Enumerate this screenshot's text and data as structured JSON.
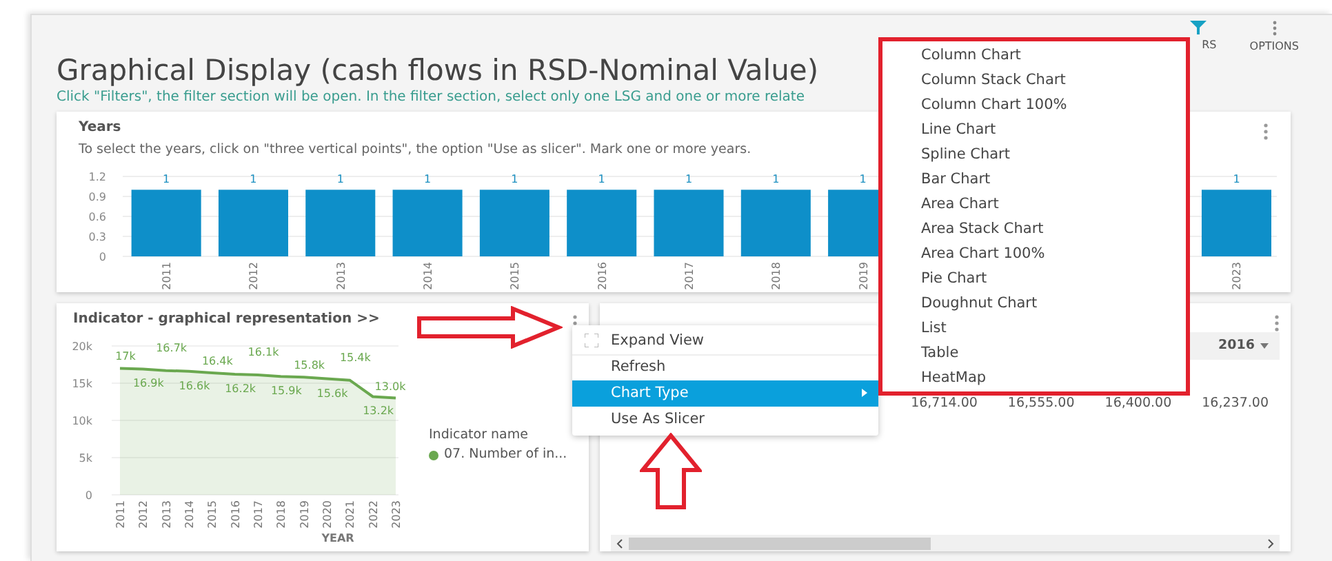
{
  "toolbar": {
    "filters_label": "RS",
    "options_label": "OPTIONS"
  },
  "page": {
    "title": "Graphical Display (cash flows in RSD-Nominal Value)",
    "hint": "Click \"Filters\", the filter section will be open. In the filter section, select only one LSG and one or more relate"
  },
  "years_card": {
    "title": "Years",
    "description": "To select the years, click on \"three vertical points\", the option \"Use as slicer\". Mark one or more years.",
    "chart_data": {
      "type": "bar",
      "categories": [
        "2011",
        "2012",
        "2013",
        "2014",
        "2015",
        "2016",
        "2017",
        "2018",
        "2019",
        null,
        null,
        null,
        "2023"
      ],
      "series": [
        {
          "color": "#0e8fc9",
          "values": [
            1,
            1,
            1,
            1,
            1,
            1,
            1,
            1,
            1,
            null,
            null,
            null,
            1
          ]
        }
      ],
      "ylim": [
        0,
        1.2
      ],
      "yticks": [
        0,
        0.3,
        0.6,
        0.9,
        1.2
      ],
      "grid": true,
      "data_labels": true
    }
  },
  "indicator_card": {
    "title": "Indicator - graphical representation >>",
    "legend_title": "Indicator name",
    "chart_data": {
      "type": "area",
      "xlabel": "YEAR",
      "x": [
        "2011",
        "2012",
        "2013",
        "2014",
        "2015",
        "2016",
        "2017",
        "2018",
        "2019",
        "2020",
        "2021",
        "2022",
        "2023"
      ],
      "series": [
        {
          "name": "07. Number of in...",
          "color": "#6aa84f",
          "values": [
            17000,
            16900,
            16700,
            16600,
            16400,
            16200,
            16100,
            15900,
            15800,
            15600,
            15400,
            13200,
            13000
          ]
        }
      ],
      "ylim": [
        0,
        20000
      ],
      "grid": true,
      "yticks": [
        {
          "value": 0,
          "label": "0"
        },
        {
          "value": 5000,
          "label": "5k"
        },
        {
          "value": 10000,
          "label": "10k"
        },
        {
          "value": 15000,
          "label": "15k"
        },
        {
          "value": 20000,
          "label": "20k"
        }
      ],
      "value_labels": [
        "17k",
        "16.9k",
        "16.7k",
        "16.6k",
        "16.4k",
        "16.2k",
        "16.1k",
        "15.9k",
        "15.8k",
        "15.6k",
        "15.4k",
        "13.2k",
        "13.0k"
      ]
    }
  },
  "table_card": {
    "column_header": "2016",
    "cells": [
      "16,714.00",
      "16,555.00",
      "16,400.00",
      "16,237.00"
    ]
  },
  "context_menu": [
    {
      "label": "Expand View",
      "kind": "expand",
      "selected": false
    },
    {
      "label": "Refresh",
      "kind": "plain",
      "selected": false
    },
    {
      "label": "Chart Type",
      "kind": "submenu",
      "selected": true
    },
    {
      "label": "Use As Slicer",
      "kind": "plain",
      "selected": false
    }
  ],
  "chart_type_menu": [
    "Column Chart",
    "Column Stack Chart",
    "Column Chart 100%",
    "Line Chart",
    "Spline Chart",
    "Bar Chart",
    "Area Chart",
    "Area Stack Chart",
    "Area Chart 100%",
    "Pie Chart",
    "Doughnut Chart",
    "List",
    "Table",
    "HeatMap"
  ]
}
